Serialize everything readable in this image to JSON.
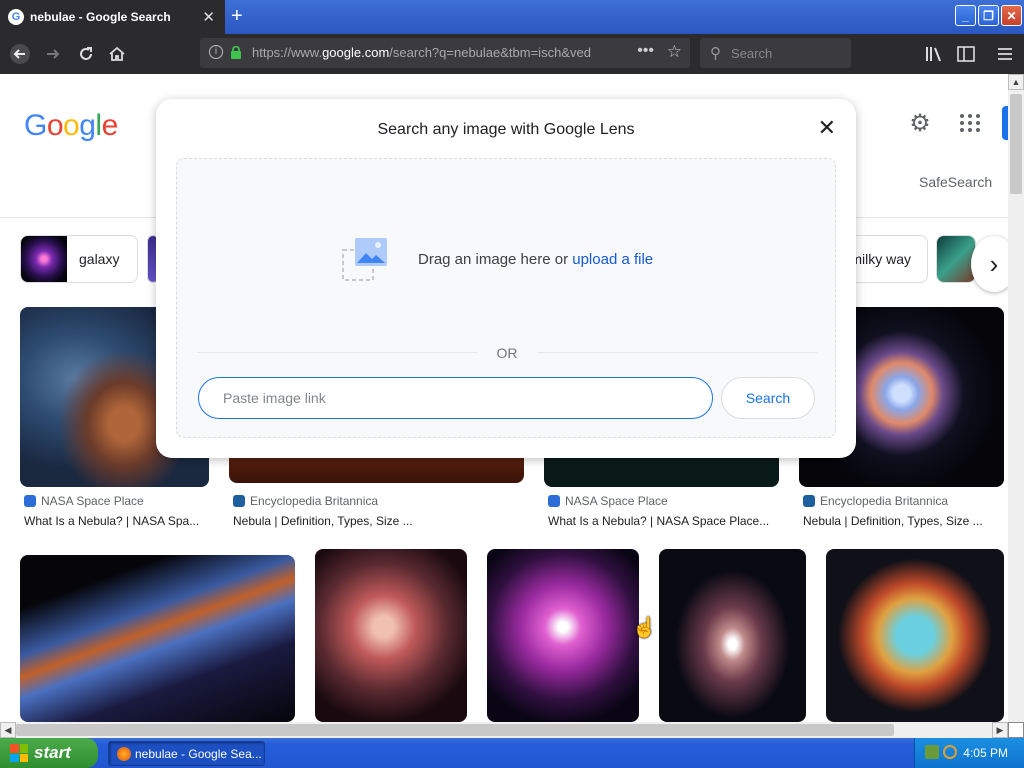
{
  "browser": {
    "tab_title": "nebulae - Google Search",
    "tab_close": "✕",
    "new_tab": "+",
    "url_prefix": "https://www.",
    "url_domain": "google.com",
    "url_rest": "/search?q=nebulae&tbm=isch&ved",
    "search_placeholder": "Search",
    "window_buttons": [
      "_",
      "❐",
      "✕"
    ]
  },
  "page": {
    "logo_letters": [
      {
        "ch": "G",
        "color": "#4285f4"
      },
      {
        "ch": "o",
        "color": "#ea4335"
      },
      {
        "ch": "o",
        "color": "#fbbc05"
      },
      {
        "ch": "g",
        "color": "#4285f4"
      },
      {
        "ch": "l",
        "color": "#34a853"
      },
      {
        "ch": "e",
        "color": "#ea4335"
      }
    ],
    "safesearch": "SafeSearch",
    "chips": [
      {
        "label": "galaxy"
      },
      {
        "label": "milky way"
      }
    ],
    "results_row1": [
      {
        "source": "NASA Space Place",
        "title": "What Is a Nebula? | NASA Spa..."
      },
      {
        "source": "Encyclopedia Britannica",
        "title": "Nebula | Definition, Types, Size ..."
      },
      {
        "source": "NASA Space Place",
        "title": "What Is a Nebula? | NASA Space Place..."
      },
      {
        "source": "Encyclopedia Britannica",
        "title": "Nebula | Definition, Types, Size ..."
      }
    ]
  },
  "lens": {
    "title": "Search any image with Google Lens",
    "drag_text": "Drag an image here or ",
    "upload_link": "upload a file",
    "or": "OR",
    "input_placeholder": "Paste image link",
    "search_button": "Search"
  },
  "taskbar": {
    "start": "start",
    "task": "nebulae - Google Sea...",
    "clock": "4:05 PM"
  }
}
